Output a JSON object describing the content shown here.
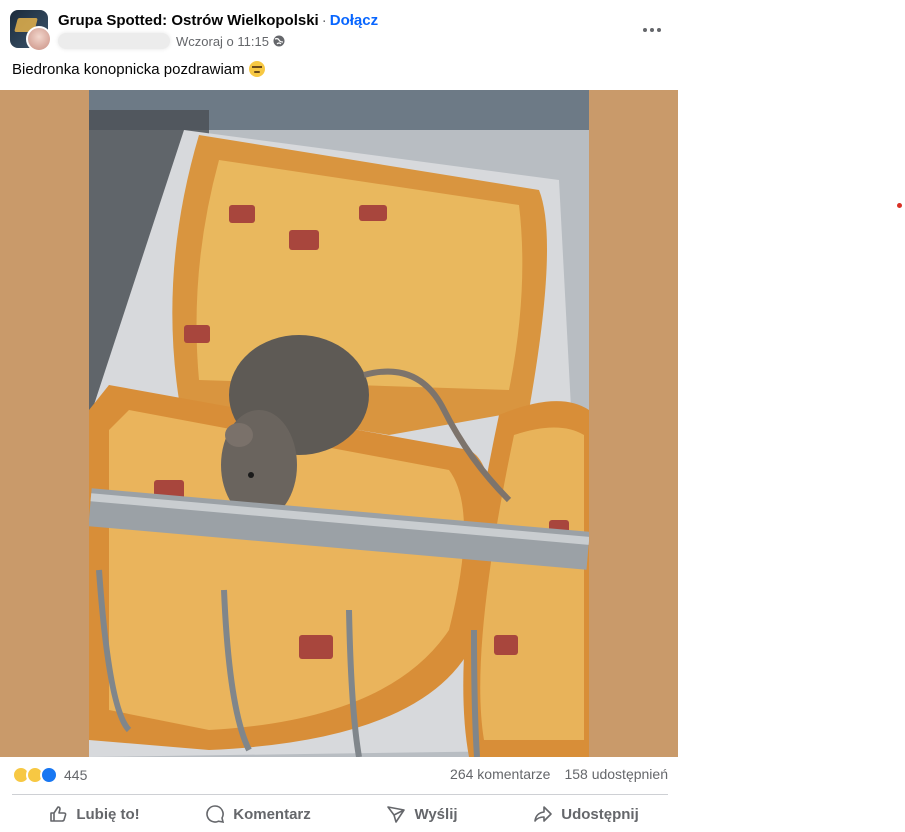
{
  "post": {
    "group_name": "Grupa Spotted: Ostrów Wielkopolski",
    "separator": "·",
    "join_label": "Dołącz",
    "timestamp": "Wczoraj o 11:15",
    "text": "Biedronka konopnicka pozdrawiam",
    "emoji": "face-with-raised-eyebrow"
  },
  "photo": {
    "description_icon": "photo-mouse-on-pizza"
  },
  "stats": {
    "reactions": [
      "wow",
      "haha",
      "like"
    ],
    "reaction_count": "445",
    "comments": "264 komentarze",
    "shares": "158 udostępnień"
  },
  "actions": {
    "like": "Lubię to!",
    "comment": "Komentarz",
    "send": "Wyślij",
    "share": "Udostępnij"
  },
  "colors": {
    "accent": "#0866ff",
    "photo_background": "#c99a6a",
    "secondary_text": "#65676b"
  }
}
